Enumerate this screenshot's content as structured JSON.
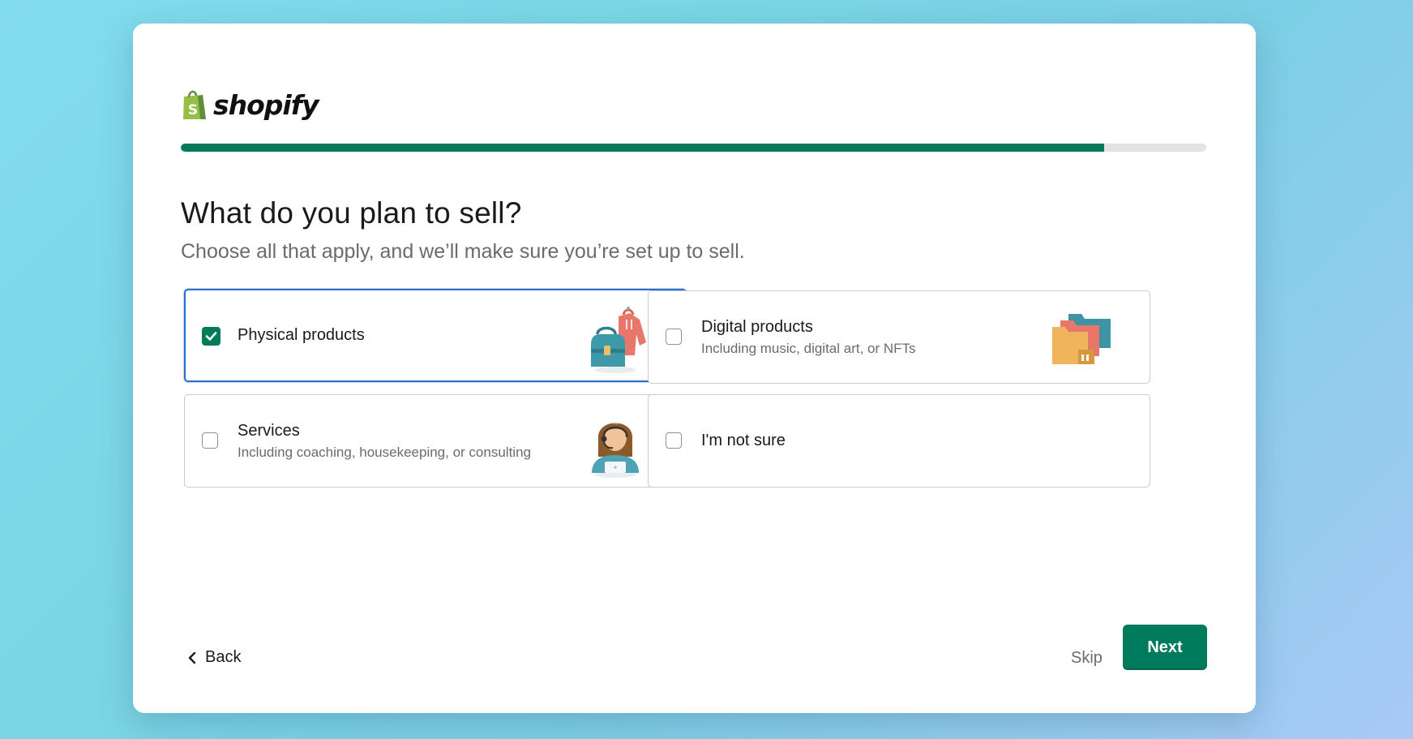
{
  "brand": {
    "name": "shopify",
    "logo_icon": "shopify-bag-icon",
    "color": "#95bf47"
  },
  "progress": {
    "fraction": 0.9
  },
  "page": {
    "title": "What do you plan to sell?",
    "subtitle": "Choose all that apply, and we’ll make sure you’re set up to sell."
  },
  "options": [
    {
      "title": "Physical products",
      "description": "",
      "checked": true,
      "icon": "physical-products-illustration-icon"
    },
    {
      "title": "Digital products",
      "description": "Including music, digital art, or NFTs",
      "checked": false,
      "icon": "digital-products-folders-icon"
    },
    {
      "title": "Services",
      "description": "Including coaching, housekeeping, or consulting",
      "checked": false,
      "icon": "services-person-headset-icon"
    },
    {
      "title": "I'm not sure",
      "description": "",
      "checked": false,
      "icon": ""
    }
  ],
  "footer": {
    "back_label": "Back",
    "skip_label": "Skip",
    "next_label": "Next"
  },
  "colors": {
    "accent": "#047a5a",
    "selected_border": "#2c6ecb",
    "next_button": "#007a5c"
  }
}
